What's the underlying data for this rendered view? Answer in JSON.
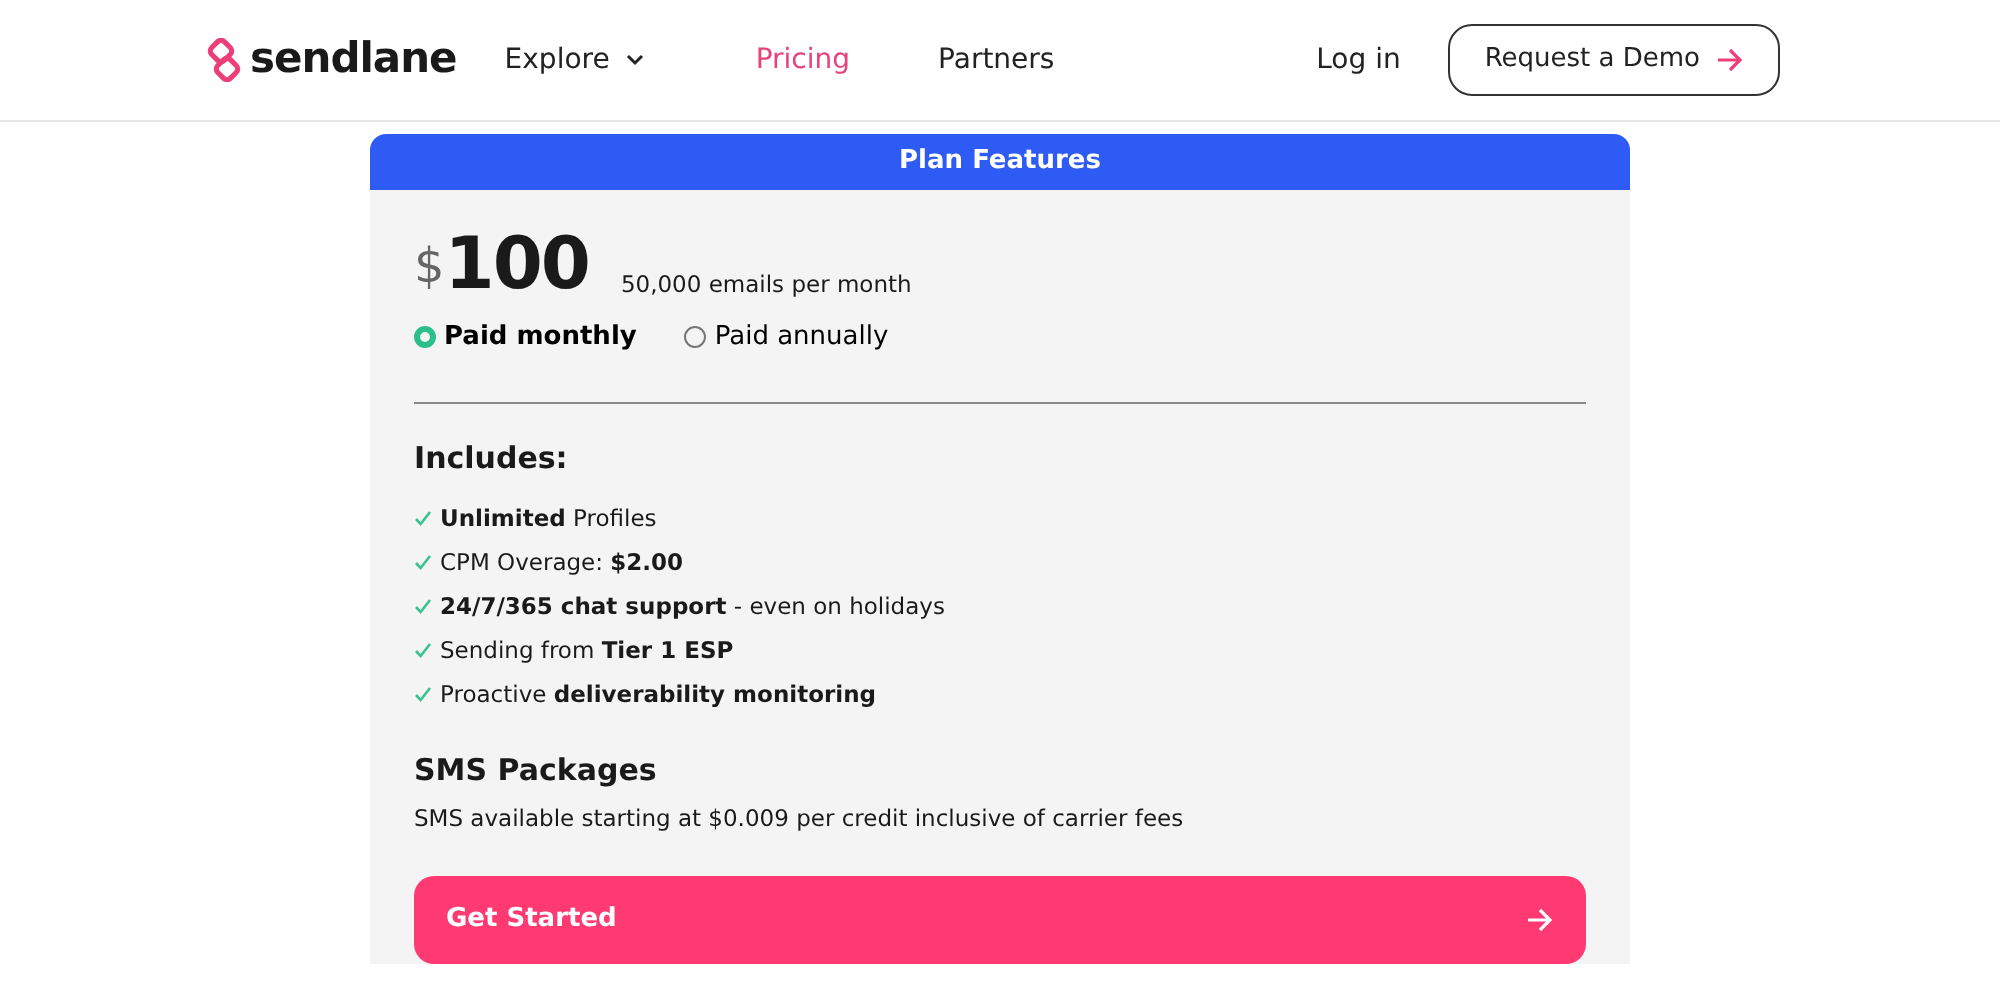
{
  "header": {
    "logo": "sendlane",
    "nav": [
      {
        "label": "Explore",
        "dropdown": true,
        "selected": false
      },
      {
        "label": "Pricing",
        "dropdown": false,
        "selected": true
      },
      {
        "label": "Partners",
        "dropdown": false,
        "selected": false
      }
    ],
    "login": "Log in",
    "demo_button": "Request a Demo"
  },
  "plan": {
    "title": "Plan Features",
    "currency": "$",
    "price": "100",
    "volume": "50,000 emails per month",
    "billing": [
      {
        "label": "Paid monthly",
        "selected": true
      },
      {
        "label": "Paid annually",
        "selected": false
      }
    ],
    "includes_title": "Includes:",
    "features": [
      "**Unlimited** Profiles",
      "CPM Overage: **$2.00**",
      "**24/7/365 chat support** - even on holidays",
      "Sending from **Tier 1 ESP**",
      "Proactive **deliverability monitoring**"
    ],
    "sms_title": "SMS Packages",
    "sms_text": "SMS available starting at $0.009 per credit inclusive of carrier fees",
    "cta": "Get Started"
  }
}
